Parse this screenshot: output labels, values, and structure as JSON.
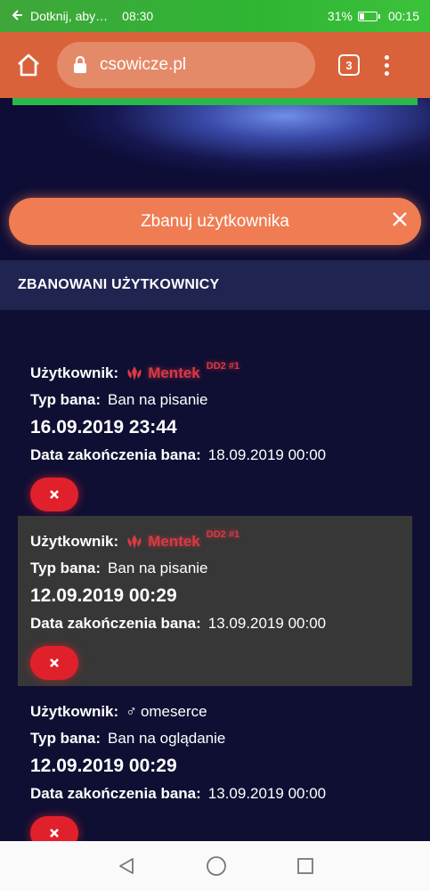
{
  "status_bar": {
    "notification_text": "Dotknij, aby…",
    "time_left": "08:30",
    "battery_pct": "31%",
    "battery_level": 0.31,
    "time_right": "00:15"
  },
  "browser": {
    "url": "csowicze.pl",
    "tab_count": "3"
  },
  "ban_button": {
    "label": "Zbanuj użytkownika"
  },
  "section": {
    "title": "ZBANOWANI UŻYTKOWNICY"
  },
  "bans": [
    {
      "user_label": "Użytkownik:",
      "user_name": "Mentek",
      "user_tag": "DD2 #1",
      "type_label": "Typ bana:",
      "type_value": "Ban na pisanie",
      "date": "16.09.2019 23:44",
      "end_label": "Data zakończenia bana:",
      "end_value": "18.09.2019 00:00"
    },
    {
      "user_label": "Użytkownik:",
      "user_name": "Mentek",
      "user_tag": "DD2 #1",
      "type_label": "Typ bana:",
      "type_value": "Ban na pisanie",
      "date": "12.09.2019 00:29",
      "end_label": "Data zakończenia bana:",
      "end_value": "13.09.2019 00:00"
    },
    {
      "user_label": "Użytkownik:",
      "user_name": "omeserce",
      "user_icon": "♂",
      "type_label": "Typ bana:",
      "type_value": "Ban na oglądanie",
      "date": "12.09.2019 00:29",
      "end_label": "Data zakończenia bana:",
      "end_value": "13.09.2019 00:00"
    }
  ],
  "icons": {
    "back": "arrow-left-icon",
    "home": "home-icon",
    "lock": "lock-icon",
    "menu": "more-vert-icon",
    "close": "close-icon",
    "unban": "close-icon",
    "rank": "rank-emblem-icon"
  },
  "colors": {
    "status_bar": "#2fb534",
    "toolbar": "#d9623b",
    "accent": "#ef7c52",
    "nick": "#d93a44",
    "unban": "#e0212b",
    "background": "#0f0f33"
  }
}
